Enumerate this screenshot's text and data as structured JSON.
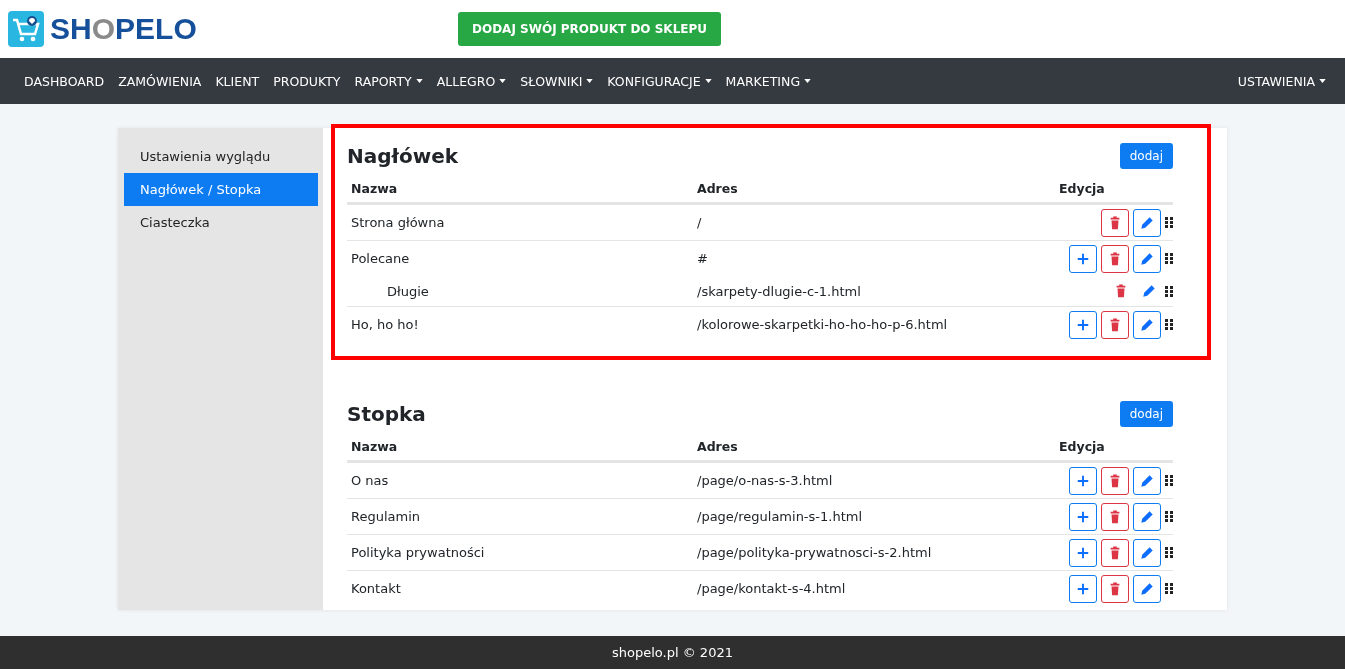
{
  "header": {
    "logo": {
      "brand_start": "SH",
      "brand_mid": "O",
      "brand_end": "PELO"
    },
    "cta": "DODAJ SWÓJ PRODUKT DO SKLEPU"
  },
  "nav": {
    "items": [
      {
        "label": "DASHBOARD",
        "dropdown": false
      },
      {
        "label": "ZAMÓWIENIA",
        "dropdown": false
      },
      {
        "label": "KLIENT",
        "dropdown": false
      },
      {
        "label": "PRODUKTY",
        "dropdown": false
      },
      {
        "label": "RAPORTY",
        "dropdown": true
      },
      {
        "label": "ALLEGRO",
        "dropdown": true
      },
      {
        "label": "SŁOWNIKI",
        "dropdown": true
      },
      {
        "label": "KONFIGURACJE",
        "dropdown": true
      },
      {
        "label": "MARKETING",
        "dropdown": true
      }
    ],
    "right": {
      "label": "USTAWIENIA",
      "dropdown": true
    }
  },
  "sidebar": {
    "items": [
      {
        "label": "Ustawienia wyglądu",
        "selected": false
      },
      {
        "label": "Nagłówek / Stopka",
        "selected": true
      },
      {
        "label": "Ciasteczka",
        "selected": false
      }
    ]
  },
  "sections": [
    {
      "title": "Nagłówek",
      "highlighted": true,
      "add_button": "dodaj",
      "columns": [
        "Nazwa",
        "Adres",
        "Edycja"
      ],
      "rows": [
        {
          "name": "Strona główna",
          "address": "/",
          "actions": [
            {
              "kind": "delete"
            },
            {
              "kind": "edit"
            }
          ],
          "children": []
        },
        {
          "name": "Polecane",
          "address": "#",
          "actions": [
            {
              "kind": "add"
            },
            {
              "kind": "delete"
            },
            {
              "kind": "edit"
            }
          ],
          "children": [
            {
              "name": "Długie",
              "address": "/skarpety-dlugie-c-1.html",
              "actions": [
                {
                  "kind": "delete"
                },
                {
                  "kind": "edit"
                }
              ]
            }
          ]
        },
        {
          "name": "Ho, ho ho!",
          "address": "/kolorowe-skarpetki-ho-ho-ho-p-6.html",
          "actions": [
            {
              "kind": "add"
            },
            {
              "kind": "delete"
            },
            {
              "kind": "edit"
            }
          ],
          "children": []
        }
      ]
    },
    {
      "title": "Stopka",
      "highlighted": false,
      "add_button": "dodaj",
      "columns": [
        "Nazwa",
        "Adres",
        "Edycja"
      ],
      "rows": [
        {
          "name": "O nas",
          "address": "/page/o-nas-s-3.html",
          "actions": [
            {
              "kind": "add"
            },
            {
              "kind": "delete"
            },
            {
              "kind": "edit"
            }
          ],
          "children": []
        },
        {
          "name": "Regulamin",
          "address": "/page/regulamin-s-1.html",
          "actions": [
            {
              "kind": "add"
            },
            {
              "kind": "delete"
            },
            {
              "kind": "edit"
            }
          ],
          "children": []
        },
        {
          "name": "Polityka prywatności",
          "address": "/page/polityka-prywatnosci-s-2.html",
          "actions": [
            {
              "kind": "add"
            },
            {
              "kind": "delete"
            },
            {
              "kind": "edit"
            }
          ],
          "children": []
        },
        {
          "name": "Kontakt",
          "address": "/page/kontakt-s-4.html",
          "actions": [
            {
              "kind": "add"
            },
            {
              "kind": "delete"
            },
            {
              "kind": "edit"
            }
          ],
          "children": []
        }
      ]
    }
  ],
  "footer": {
    "text": "shopelo.pl © 2021"
  }
}
